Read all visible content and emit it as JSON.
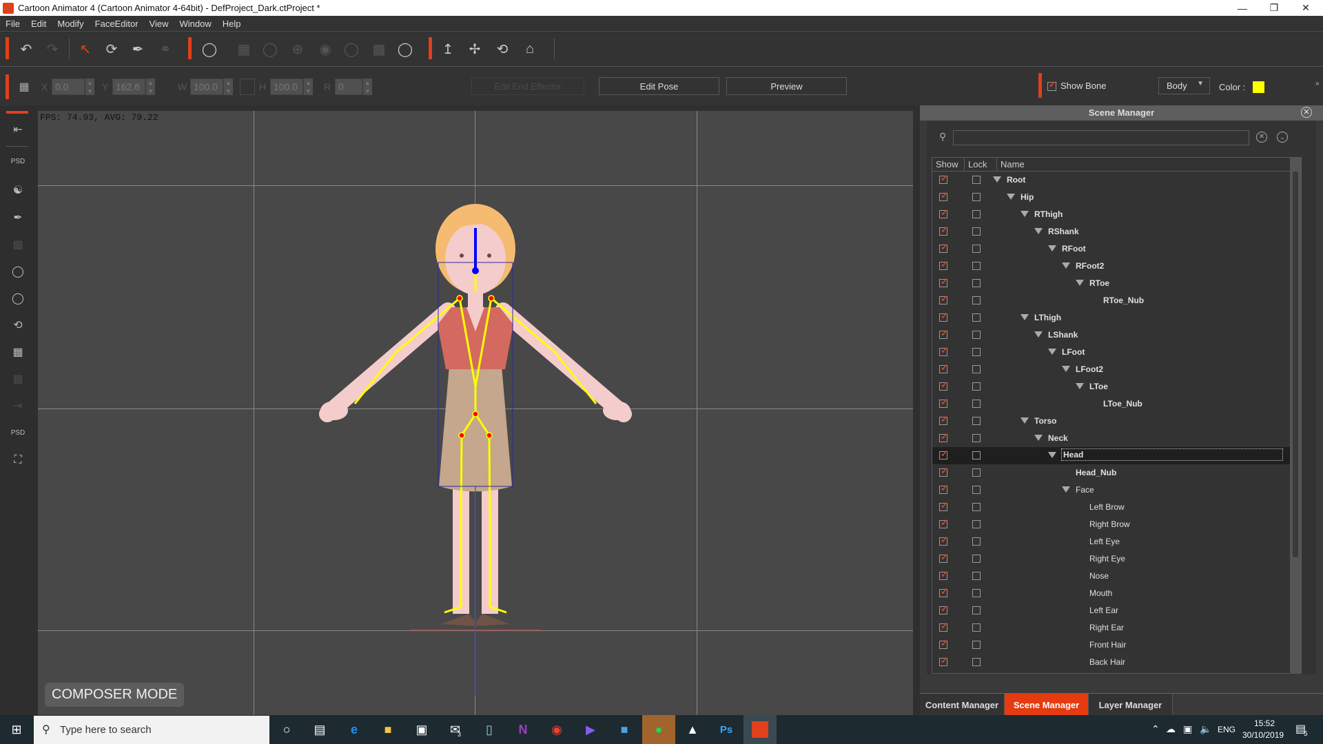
{
  "window": {
    "title": "Cartoon Animator 4  (Cartoon Animator 4-64bit) - DefProject_Dark.ctProject *",
    "controls": [
      "minimize-icon",
      "restore-icon",
      "close-icon"
    ]
  },
  "menu": [
    "File",
    "Edit",
    "Modify",
    "FaceEditor",
    "View",
    "Window",
    "Help"
  ],
  "toolbar": {
    "icons": [
      "undo-icon",
      "redo-icon",
      "select-icon",
      "transform-bone-icon",
      "bone-editor-icon",
      "link-icon",
      "face-key-icon",
      "sprite-timeline-icon",
      "head-turn-icon",
      "face-puppet-icon",
      "eye-icon",
      "lip-sync-icon",
      "mask-icon",
      "face-reset-icon",
      "pin-icon",
      "move-icon",
      "rotate-icon",
      "home-icon"
    ]
  },
  "transform": {
    "x_label": "X",
    "x_value": "0.0",
    "y_label": "Y",
    "y_value": "162.6",
    "w_label": "W",
    "w_value": "100.0",
    "h_label": "H",
    "h_value": "100.0",
    "r_label": "R",
    "r_value": "0",
    "edit_end_effector": "Edit End Effector",
    "edit_pose": "Edit Pose",
    "preview": "Preview",
    "show_bone_label": "Show Bone",
    "show_bone_checked": true,
    "body_select": "Body",
    "color_label": "Color :",
    "bone_color": "#ffff00"
  },
  "viewport": {
    "fps": "FPS: 74.93, AVG: 79.22",
    "mode": "COMPOSER MODE"
  },
  "scene_manager": {
    "title": "Scene Manager",
    "search_placeholder": "",
    "columns": [
      "Show",
      "Lock",
      "Name"
    ],
    "rows": [
      {
        "name": "Root",
        "depth": 0,
        "expand": true,
        "bold": true
      },
      {
        "name": "Hip",
        "depth": 1,
        "expand": true,
        "bold": true
      },
      {
        "name": "RThigh",
        "depth": 2,
        "expand": true,
        "bold": true
      },
      {
        "name": "RShank",
        "depth": 3,
        "expand": true,
        "bold": true
      },
      {
        "name": "RFoot",
        "depth": 4,
        "expand": true,
        "bold": true
      },
      {
        "name": "RFoot2",
        "depth": 5,
        "expand": true,
        "bold": true
      },
      {
        "name": "RToe",
        "depth": 6,
        "expand": true,
        "bold": true
      },
      {
        "name": "RToe_Nub",
        "depth": 7,
        "expand": false,
        "bold": true
      },
      {
        "name": "LThigh",
        "depth": 2,
        "expand": true,
        "bold": true
      },
      {
        "name": "LShank",
        "depth": 3,
        "expand": true,
        "bold": true
      },
      {
        "name": "LFoot",
        "depth": 4,
        "expand": true,
        "bold": true
      },
      {
        "name": "LFoot2",
        "depth": 5,
        "expand": true,
        "bold": true
      },
      {
        "name": "LToe",
        "depth": 6,
        "expand": true,
        "bold": true
      },
      {
        "name": "LToe_Nub",
        "depth": 7,
        "expand": false,
        "bold": true
      },
      {
        "name": "Torso",
        "depth": 2,
        "expand": true,
        "bold": true
      },
      {
        "name": "Neck",
        "depth": 3,
        "expand": true,
        "bold": true
      },
      {
        "name": "Head",
        "depth": 4,
        "expand": true,
        "bold": true,
        "selected": true
      },
      {
        "name": "Head_Nub",
        "depth": 5,
        "expand": false,
        "bold": true
      },
      {
        "name": "Face",
        "depth": 5,
        "expand": true,
        "bold": false
      },
      {
        "name": "Left Brow",
        "depth": 6,
        "expand": false,
        "bold": false
      },
      {
        "name": "Right Brow",
        "depth": 6,
        "expand": false,
        "bold": false
      },
      {
        "name": "Left Eye",
        "depth": 6,
        "expand": false,
        "bold": false
      },
      {
        "name": "Right Eye",
        "depth": 6,
        "expand": false,
        "bold": false
      },
      {
        "name": "Nose",
        "depth": 6,
        "expand": false,
        "bold": false
      },
      {
        "name": "Mouth",
        "depth": 6,
        "expand": false,
        "bold": false
      },
      {
        "name": "Left Ear",
        "depth": 6,
        "expand": false,
        "bold": false
      },
      {
        "name": "Right Ear",
        "depth": 6,
        "expand": false,
        "bold": false
      },
      {
        "name": "Front Hair",
        "depth": 6,
        "expand": false,
        "bold": false
      },
      {
        "name": "Back Hair",
        "depth": 6,
        "expand": false,
        "bold": false
      }
    ],
    "tabs": [
      "Content Manager",
      "Scene Manager",
      "Layer Manager"
    ],
    "active_tab": "Scene Manager"
  },
  "taskbar": {
    "search_placeholder": "Type here to search",
    "apps": [
      "cortana-icon",
      "task-view-icon",
      "edge-icon",
      "file-explorer-icon",
      "store-icon",
      "mail-icon",
      "notepad-icon",
      "onenote-icon",
      "chrome-icon",
      "media-player-icon",
      "brain-app-icon",
      "spotify-icon",
      "photos-icon",
      "photoshop-icon",
      "cartoon-animator-icon"
    ],
    "mail_badge": "3",
    "language": "ENG",
    "time": "15:52",
    "date": "30/10/2019",
    "notifications": "5"
  },
  "colors": {
    "accent": "#e63a10",
    "bone": "#ffff00",
    "selection": "#1f1f1f"
  }
}
